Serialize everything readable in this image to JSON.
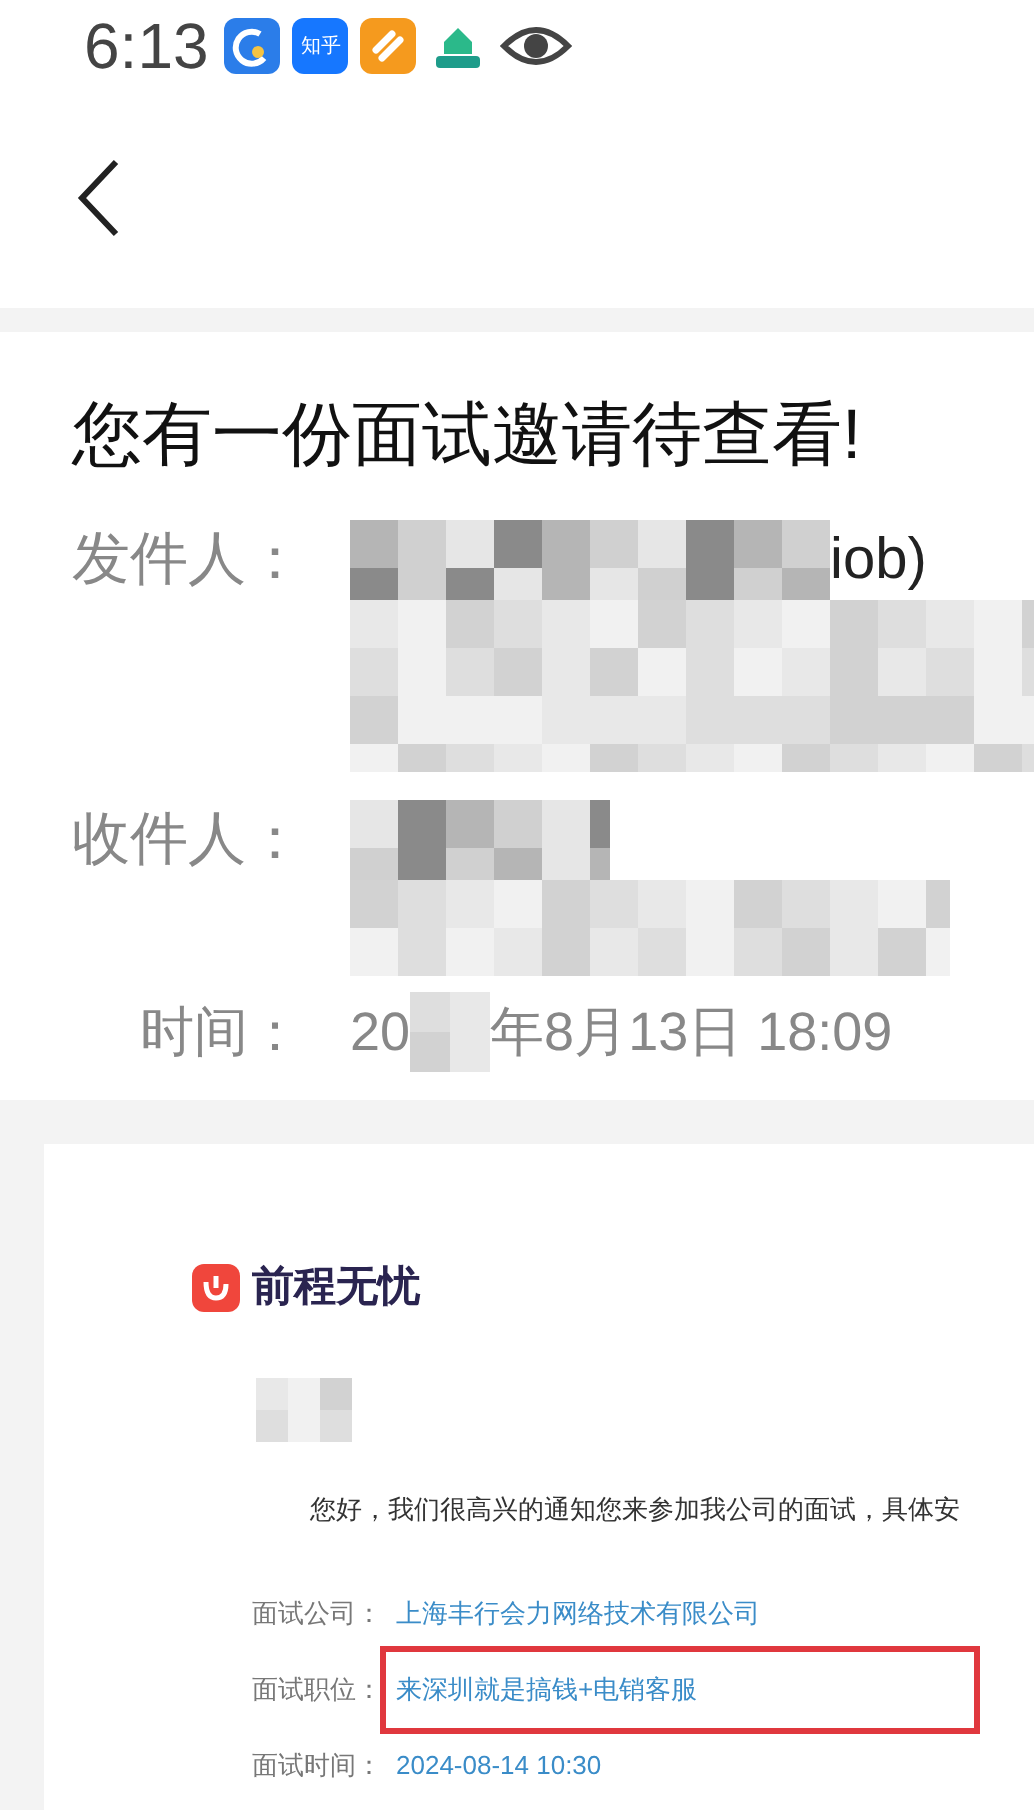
{
  "status_bar": {
    "time": "6:13",
    "zhihu_label": "知乎"
  },
  "email": {
    "subject": "您有一份面试邀请待查看!",
    "sender": {
      "label": "发件人：",
      "visible_text": "iob)"
    },
    "recipient": {
      "label": "收件人："
    },
    "time": {
      "label": "时间：",
      "year_prefix": "20",
      "rest": "年8月13日 18:09"
    }
  },
  "body": {
    "logo_text": "前程无忧",
    "greeting": "您好，我们很高兴的通知您来参加我公司的面试，具体安",
    "details": [
      {
        "label": "面试公司：",
        "value": "上海丰行会力网络技术有限公司",
        "highlighted": false
      },
      {
        "label": "面试职位：",
        "value": "来深圳就是搞钱+电销客服",
        "highlighted": true
      },
      {
        "label": "面试时间：",
        "value": "2024-08-14 10:30",
        "highlighted": false
      }
    ]
  }
}
